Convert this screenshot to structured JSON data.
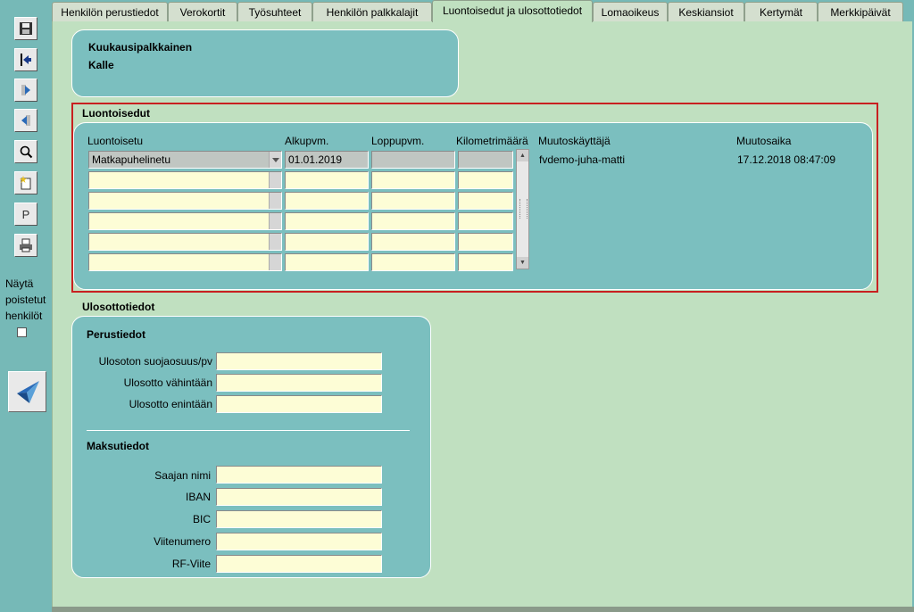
{
  "tabs": [
    {
      "label": "Henkilön perustiedot",
      "active": false
    },
    {
      "label": "Verokortit",
      "active": false
    },
    {
      "label": "Työsuhteet",
      "active": false
    },
    {
      "label": "Henkilön palkkalajit",
      "active": false
    },
    {
      "label": "Luontoisedut ja ulosottotiedot",
      "active": true
    },
    {
      "label": "Lomaoikeus",
      "active": false
    },
    {
      "label": "Keskiansiot",
      "active": false
    },
    {
      "label": "Kertymät",
      "active": false
    },
    {
      "label": "Merkkipäivät",
      "active": false
    }
  ],
  "toolbar": {
    "items": [
      "save-icon",
      "back-icon",
      "next-icon",
      "previous-icon",
      "search-icon",
      "new-record-icon",
      "p-button",
      "print-icon"
    ],
    "p_label": "P"
  },
  "sidebar": {
    "show_deleted_label_1": "Näytä",
    "show_deleted_label_2": "poistetut",
    "show_deleted_label_3": "henkilöt"
  },
  "person": {
    "line1": "Kuukausipalkkainen",
    "line2": "Kalle"
  },
  "benefits": {
    "section_title": "Luontoisedut",
    "headers": {
      "benefit": "Luontoisetu",
      "start": "Alkupvm.",
      "end": "Loppupvm.",
      "km": "Kilometrimäärä",
      "modifier": "Muutoskäyttäjä",
      "modified": "Muutosaika"
    },
    "rows": [
      {
        "benefit": "Matkapuhelinetu",
        "start": "01.01.2019",
        "end": "",
        "km": "",
        "modifier": "fvdemo-juha-matti",
        "modified": "17.12.2018 08:47:09"
      },
      {
        "benefit": "",
        "start": "",
        "end": "",
        "km": "",
        "modifier": "",
        "modified": ""
      },
      {
        "benefit": "",
        "start": "",
        "end": "",
        "km": "",
        "modifier": "",
        "modified": ""
      },
      {
        "benefit": "",
        "start": "",
        "end": "",
        "km": "",
        "modifier": "",
        "modified": ""
      },
      {
        "benefit": "",
        "start": "",
        "end": "",
        "km": "",
        "modifier": "",
        "modified": ""
      },
      {
        "benefit": "",
        "start": "",
        "end": "",
        "km": "",
        "modifier": "",
        "modified": ""
      }
    ]
  },
  "enforcement": {
    "section_title": "Ulosottotiedot",
    "basic_title": "Perustiedot",
    "basic_fields": [
      {
        "label": "Ulosoton suojaosuus/pv",
        "value": ""
      },
      {
        "label": "Ulosotto vähintään",
        "value": ""
      },
      {
        "label": "Ulosotto enintään",
        "value": ""
      }
    ],
    "payment_title": "Maksutiedot",
    "payment_fields": [
      {
        "label": "Saajan nimi",
        "value": ""
      },
      {
        "label": "IBAN",
        "value": ""
      },
      {
        "label": "BIC",
        "value": ""
      },
      {
        "label": "Viitenumero",
        "value": ""
      },
      {
        "label": "RF-Viite",
        "value": ""
      }
    ]
  }
}
